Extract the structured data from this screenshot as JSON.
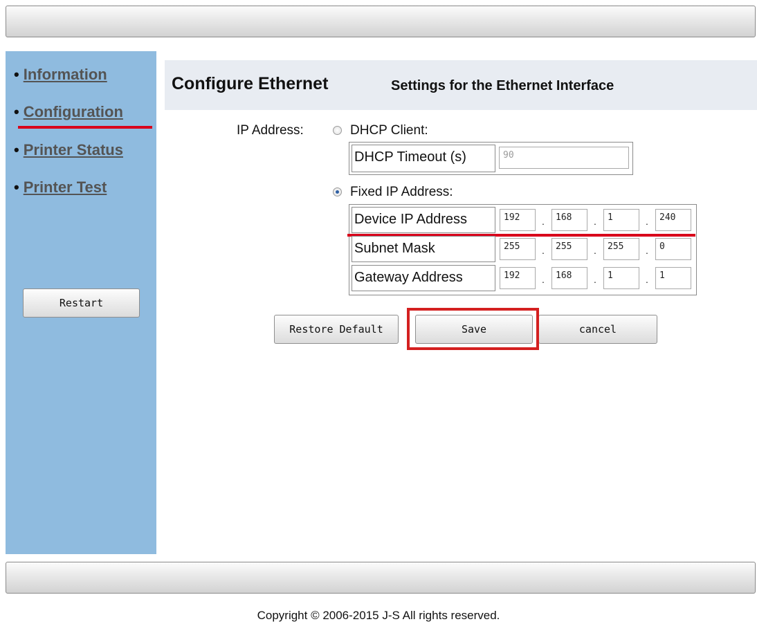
{
  "sidebar": {
    "items": [
      {
        "label": "Information"
      },
      {
        "label": "Configuration",
        "active": true
      },
      {
        "label": "Printer Status"
      },
      {
        "label": "Printer Test"
      }
    ],
    "restart_label": "Restart"
  },
  "header": {
    "title": "Configure Ethernet",
    "subtitle": "Settings for the Ethernet Interface"
  },
  "form": {
    "ip_address_label": "IP Address:",
    "dhcp": {
      "label": "DHCP Client:",
      "selected": false,
      "timeout_label": "DHCP Timeout (s)",
      "timeout_value": "90"
    },
    "fixed": {
      "label": "Fixed IP Address:",
      "selected": true,
      "rows": [
        {
          "label": "Device IP Address",
          "octets": [
            "192",
            "168",
            "1",
            "240"
          ]
        },
        {
          "label": "Subnet Mask",
          "octets": [
            "255",
            "255",
            "255",
            "0"
          ]
        },
        {
          "label": "Gateway Address",
          "octets": [
            "192",
            "168",
            "1",
            "1"
          ]
        }
      ],
      "separator": "."
    }
  },
  "buttons": {
    "restore": "Restore Default",
    "save": "Save",
    "cancel": "cancel"
  },
  "footer": {
    "copyright": "Copyright © 2006-2015 J-S All rights reserved."
  },
  "colors": {
    "sidebar_bg": "#8fbbdf",
    "header_band": "#e8ecf2",
    "highlight_red": "#d9001b",
    "link": "#545454"
  }
}
